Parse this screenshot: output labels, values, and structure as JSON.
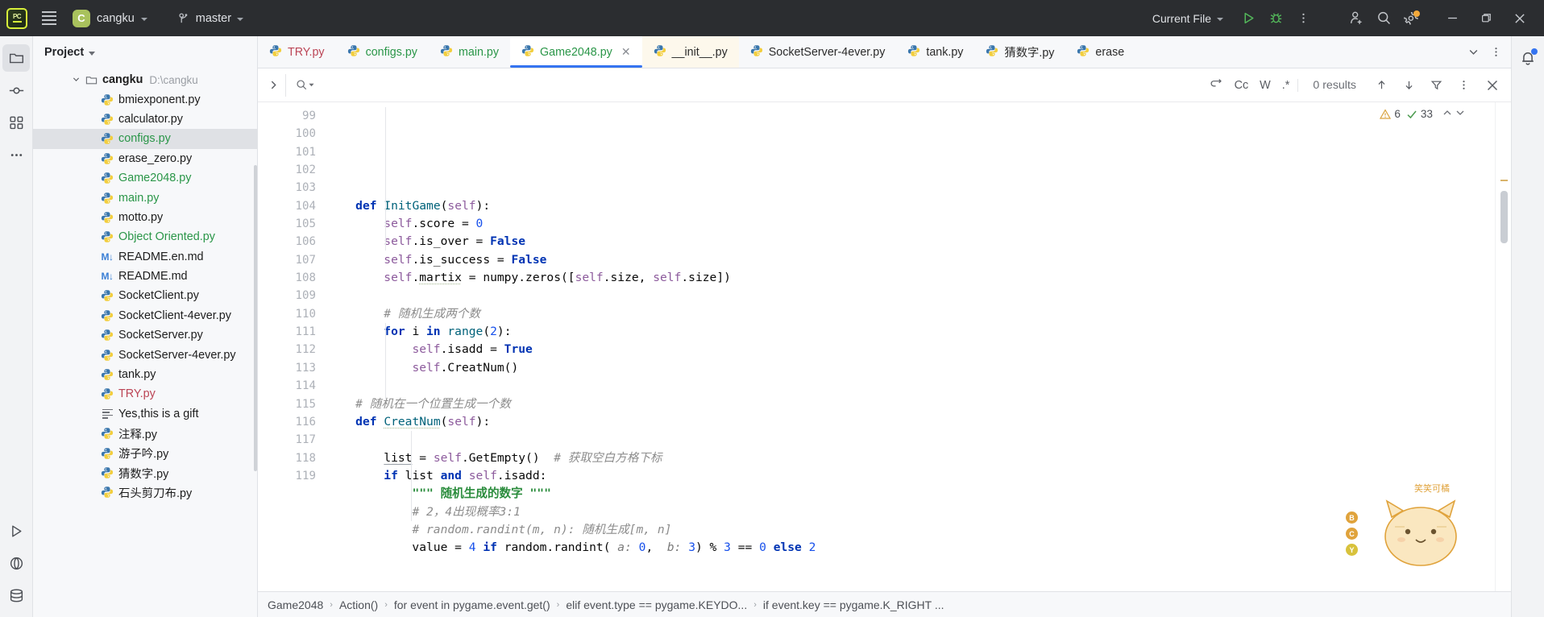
{
  "titlebar": {
    "logo_text": "PC",
    "project_initial": "C",
    "project_name": "cangku",
    "branch_name": "master",
    "run_config": "Current File",
    "icons": {
      "burger": "hamburger-menu-icon",
      "run": "run-icon",
      "debug": "debug-icon",
      "more": "more-vertical-icon",
      "account": "account-add-icon",
      "search": "search-icon",
      "settings": "settings-gear-icon"
    },
    "window": {
      "minimize": "–",
      "maximize": "❐",
      "close": "✕"
    }
  },
  "rail": {
    "items": [
      {
        "name": "project-explorer",
        "icon": "folder-icon",
        "active": true
      },
      {
        "name": "commit",
        "icon": "commit-icon",
        "active": false
      },
      {
        "name": "structure",
        "icon": "structure-icon",
        "active": false
      },
      {
        "name": "more-tool-windows",
        "icon": "ellipsis-icon",
        "active": false
      }
    ],
    "bottom_items": [
      {
        "name": "run-tool-window",
        "icon": "run-triangle-icon"
      },
      {
        "name": "python-packages",
        "icon": "python-packages-icon"
      },
      {
        "name": "database",
        "icon": "database-icon"
      }
    ]
  },
  "panel": {
    "title": "Project",
    "root": {
      "label": "cangku",
      "path": "D:\\cangku",
      "expanded": true
    },
    "files": [
      {
        "label": "bmiexponent.py",
        "icon": "python-file-icon",
        "color": "default"
      },
      {
        "label": "calculator.py",
        "icon": "python-file-icon",
        "color": "default"
      },
      {
        "label": "configs.py",
        "icon": "python-file-icon",
        "color": "green",
        "selected": true
      },
      {
        "label": "erase_zero.py",
        "icon": "python-file-icon",
        "color": "default"
      },
      {
        "label": "Game2048.py",
        "icon": "python-file-icon",
        "color": "green"
      },
      {
        "label": "main.py",
        "icon": "python-file-icon",
        "color": "green"
      },
      {
        "label": "motto.py",
        "icon": "python-file-icon",
        "color": "default"
      },
      {
        "label": "Object Oriented.py",
        "icon": "python-file-icon",
        "color": "green"
      },
      {
        "label": "README.en.md",
        "icon": "markdown-file-icon",
        "color": "default"
      },
      {
        "label": "README.md",
        "icon": "markdown-file-icon",
        "color": "default"
      },
      {
        "label": "SocketClient.py",
        "icon": "python-file-icon",
        "color": "default"
      },
      {
        "label": "SocketClient-4ever.py",
        "icon": "python-file-icon",
        "color": "default"
      },
      {
        "label": "SocketServer.py",
        "icon": "python-file-icon",
        "color": "default"
      },
      {
        "label": "SocketServer-4ever.py",
        "icon": "python-file-icon",
        "color": "default"
      },
      {
        "label": "tank.py",
        "icon": "python-file-icon",
        "color": "default"
      },
      {
        "label": "TRY.py",
        "icon": "python-file-icon",
        "color": "red"
      },
      {
        "label": "Yes,this is a gift",
        "icon": "text-file-icon",
        "color": "default"
      },
      {
        "label": "注释.py",
        "icon": "python-file-icon",
        "color": "default"
      },
      {
        "label": "游子吟.py",
        "icon": "python-file-icon",
        "color": "default"
      },
      {
        "label": "猜数字.py",
        "icon": "python-file-icon",
        "color": "default"
      },
      {
        "label": "石头剪刀布.py",
        "icon": "python-file-icon",
        "color": "default"
      }
    ]
  },
  "tabs": {
    "items": [
      {
        "label": "TRY.py",
        "icon": "python-file-icon",
        "color": "red",
        "active": false,
        "pinned": false,
        "closable": false
      },
      {
        "label": "configs.py",
        "icon": "python-file-icon",
        "color": "green",
        "active": false,
        "pinned": false,
        "closable": false
      },
      {
        "label": "main.py",
        "icon": "python-file-icon",
        "color": "green",
        "active": false,
        "pinned": false,
        "closable": false
      },
      {
        "label": "Game2048.py",
        "icon": "python-file-icon",
        "color": "green",
        "active": true,
        "pinned": false,
        "closable": true
      },
      {
        "label": "__init__.py",
        "icon": "python-file-icon",
        "color": "default",
        "active": false,
        "pinned": true,
        "closable": false
      },
      {
        "label": "SocketServer-4ever.py",
        "icon": "python-file-icon",
        "color": "default",
        "active": false,
        "pinned": false,
        "closable": false
      },
      {
        "label": "tank.py",
        "icon": "python-file-icon",
        "color": "default",
        "active": false,
        "pinned": false,
        "closable": false
      },
      {
        "label": "猜数字.py",
        "icon": "python-file-icon",
        "color": "default",
        "active": false,
        "pinned": false,
        "closable": false
      },
      {
        "label": "erase",
        "icon": "python-file-icon",
        "color": "default",
        "active": false,
        "pinned": false,
        "closable": false
      }
    ],
    "overflow_icon": "chevron-down-icon",
    "more_icon": "more-vertical-icon"
  },
  "find": {
    "value": "",
    "placeholder": "",
    "results": "0 results",
    "options": {
      "regex_toggle": "case-preserve-icon",
      "match_case": "Cc",
      "words": "W",
      "regex": ".*"
    },
    "icons": {
      "expand": "chevron-right-icon",
      "search": "search-dropdown-icon",
      "prev": "arrow-up-icon",
      "next": "arrow-down-icon",
      "filter": "filter-icon",
      "more": "more-vertical-icon",
      "close": "close-icon"
    }
  },
  "inspections": {
    "warnings": "6",
    "checks": "33",
    "warning_icon": "warning-triangle-icon",
    "check_icon": "checkmark-icon",
    "up_icon": "chevron-up-icon",
    "down_icon": "chevron-down-icon"
  },
  "code": {
    "first_line": 99,
    "lines": [
      {
        "n": 99,
        "html": "    <span class=\"kw\">def</span> <span class=\"fn\">InitGame</span>(<span class=\"sf\">self</span>):"
      },
      {
        "n": 100,
        "html": "        <span class=\"sf\">self</span>.score = <span class=\"num\">0</span>"
      },
      {
        "n": 101,
        "html": "        <span class=\"sf\">self</span>.is_over = <span class=\"kw\">False</span>"
      },
      {
        "n": 102,
        "html": "        <span class=\"sf\">self</span>.is_success = <span class=\"kw\">False</span>"
      },
      {
        "n": 103,
        "html": "        <span class=\"sf\">self</span>.<span class=\"wavy\">martix</span> = numpy.zeros([<span class=\"sf\">self</span>.size, <span class=\"sf\">self</span>.size])"
      },
      {
        "n": 104,
        "html": ""
      },
      {
        "n": 105,
        "html": "        <span class=\"cm\"># 随机生成两个数</span>"
      },
      {
        "n": 106,
        "html": "        <span class=\"kw\">for</span> i <span class=\"kw\">in</span> <span class=\"fn\">range</span>(<span class=\"num\">2</span>):"
      },
      {
        "n": 107,
        "html": "            <span class=\"sf\">self</span>.isadd = <span class=\"kw\">True</span>"
      },
      {
        "n": 108,
        "html": "            <span class=\"sf\">self</span>.CreatNum()"
      },
      {
        "n": 109,
        "html": ""
      },
      {
        "n": 110,
        "html": "    <span class=\"cm\"># 随机在一个位置生成一个数</span>"
      },
      {
        "n": 111,
        "html": "    <span class=\"kw\">def</span> <span class=\"fn wavy\">CreatNum</span>(<span class=\"sf\">self</span>):"
      },
      {
        "n": 112,
        "html": ""
      },
      {
        "n": 113,
        "html": "        <span class=\"ul\">list</span> = <span class=\"sf\">self</span>.GetEmpty()  <span class=\"cm\"># 获取空白方格下标</span>"
      },
      {
        "n": 114,
        "html": "        <span class=\"kw\">if</span> list <span class=\"kw\">and</span> <span class=\"sf\">self</span>.isadd:"
      },
      {
        "n": 115,
        "html": "            <span class=\"str\">\"\"\" 随机生成的数字 \"\"\"</span>"
      },
      {
        "n": 116,
        "html": "            <span class=\"cm\"># 2，4出现概率3:1</span>"
      },
      {
        "n": 117,
        "html": "            <span class=\"cm\"># random.randint(m, n): 随机生成[m, n]</span>"
      },
      {
        "n": 118,
        "html": "            value = <span class=\"num\">4</span> <span class=\"kw\">if</span> random.randint( <span class=\"param\">a:</span> <span class=\"num\">0</span>,  <span class=\"param\">b:</span> <span class=\"num\">3</span>) % <span class=\"num\">3</span> == <span class=\"num\">0</span> <span class=\"kw\">else</span> <span class=\"num\">2</span>"
      },
      {
        "n": 119,
        "html": ""
      }
    ]
  },
  "breadcrumb": {
    "items": [
      "Game2048",
      "Action()",
      "for event in pygame.event.get()",
      "elif event.type == pygame.KEYDO...",
      "if event.key == pygame.K_RIGHT ..."
    ],
    "separator": "›"
  },
  "notifications": {
    "icon": "bell-icon",
    "has_badge": true
  },
  "mascot": {
    "caption": "笑笑可橘",
    "badges": [
      "B",
      "C",
      "Y"
    ]
  },
  "colors": {
    "accent": "#3574f0",
    "titlebar_bg": "#2b2d30",
    "panel_bg": "#f7f8fa",
    "editor_bg": "#ffffff",
    "green_file": "#2a9648",
    "red_file": "#bb4455",
    "pinned_tab": "#fdf8ec"
  }
}
